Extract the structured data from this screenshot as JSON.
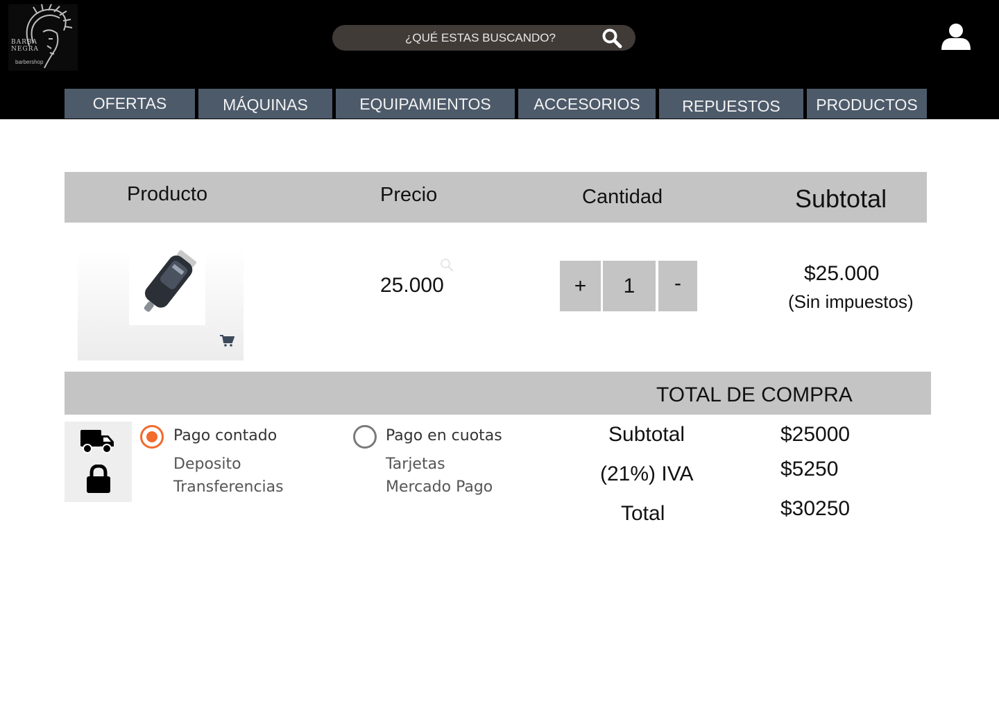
{
  "header": {
    "logo": {
      "line1": "BARBA",
      "line2": "NEGRA",
      "sub": "barbershop"
    },
    "search": {
      "placeholder": "¿QUÉ ESTAS BUSCANDO?"
    },
    "icons": {
      "search": "search-icon",
      "user": "user-icon"
    }
  },
  "nav": {
    "items": [
      {
        "label": "OFERTAS"
      },
      {
        "label": "MÁQUINAS"
      },
      {
        "label": "EQUIPAMIENTOS"
      },
      {
        "label": "ACCESORIOS"
      },
      {
        "label": "REPUESTOS"
      },
      {
        "label": "PRODUCTOS"
      }
    ]
  },
  "cart_table": {
    "headers": {
      "product": "Producto",
      "price": "Precio",
      "quantity": "Cantidad",
      "subtotal": "Subtotal"
    },
    "rows": [
      {
        "image": "hair-clipper",
        "price": "25.000",
        "quantity": "1",
        "increase": "+",
        "decrease": "-",
        "subtotal": "$25.000",
        "tax_note": "(Sin impuestos)"
      }
    ]
  },
  "payment": {
    "options": [
      {
        "label": "Pago contado",
        "selected": true,
        "methods": [
          "Deposito",
          "Transferencias"
        ]
      },
      {
        "label": "Pago en cuotas",
        "selected": false,
        "methods": [
          "Tarjetas",
          "Mercado Pago"
        ]
      }
    ],
    "icons": [
      "truck-icon",
      "lock-icon"
    ]
  },
  "totals": {
    "title": "TOTAL DE COMPRA",
    "subtotal_label": "Subtotal",
    "subtotal_value": "$25000",
    "tax_label": "(21%) IVA",
    "tax_value": "$5250",
    "total_label": "Total",
    "total_value": "$30250"
  },
  "colors": {
    "header_bg": "#000000",
    "nav_bg": "#4d5a6a",
    "table_bg": "#c4c4c4",
    "radio_accent": "#f26a2c",
    "search_bg": "#413b38"
  }
}
